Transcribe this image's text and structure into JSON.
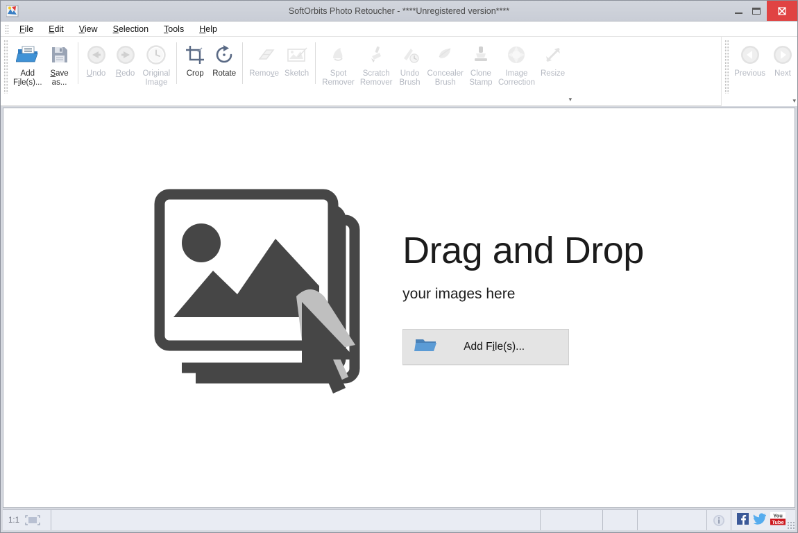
{
  "window": {
    "title": "SoftOrbits Photo Retoucher - ****Unregistered version****",
    "app_icon": "photo-retoucher-icon",
    "minimize_label": "Minimize",
    "maximize_label": "Maximize",
    "close_label": "Close",
    "close_color": "#e04343"
  },
  "menubar": {
    "items": [
      {
        "label": "File",
        "mnemonic": "F"
      },
      {
        "label": "Edit",
        "mnemonic": "E"
      },
      {
        "label": "View",
        "mnemonic": "V"
      },
      {
        "label": "Selection",
        "mnemonic": "S"
      },
      {
        "label": "Tools",
        "mnemonic": "T"
      },
      {
        "label": "Help",
        "mnemonic": "H"
      }
    ]
  },
  "toolbar": {
    "overflow_label": "▾",
    "groups": [
      {
        "name": "file-group",
        "tools": [
          {
            "name": "add-files",
            "label": "Add\nFile(s)...",
            "icon": "open-folder-icon",
            "enabled": true
          },
          {
            "name": "save-as",
            "label": "Save\nas...",
            "icon": "floppy-disk-icon",
            "enabled": true
          }
        ]
      },
      {
        "name": "history-group",
        "tools": [
          {
            "name": "undo",
            "label": "Undo",
            "icon": "arrow-left-circle-icon",
            "enabled": false
          },
          {
            "name": "redo",
            "label": "Redo",
            "icon": "arrow-right-circle-icon",
            "enabled": false
          },
          {
            "name": "original-image",
            "label": "Original\nImage",
            "icon": "clock-icon",
            "enabled": false
          }
        ]
      },
      {
        "name": "transform-group",
        "tools": [
          {
            "name": "crop",
            "label": "Crop",
            "icon": "crop-icon",
            "enabled": true
          },
          {
            "name": "rotate",
            "label": "Rotate",
            "icon": "rotate-icon",
            "enabled": true
          }
        ]
      },
      {
        "name": "effects-group",
        "tools": [
          {
            "name": "remove",
            "label": "Remove",
            "icon": "eraser-icon",
            "enabled": false
          },
          {
            "name": "sketch",
            "label": "Sketch",
            "icon": "sketch-icon",
            "enabled": false
          }
        ]
      },
      {
        "name": "retouch-group",
        "tools": [
          {
            "name": "spot-remover",
            "label": "Spot\nRemover",
            "icon": "spot-remover-icon",
            "enabled": false
          },
          {
            "name": "scratch-remover",
            "label": "Scratch\nRemover",
            "icon": "brush-icon",
            "enabled": false
          },
          {
            "name": "undo-brush",
            "label": "Undo\nBrush",
            "icon": "undo-brush-icon",
            "enabled": false
          },
          {
            "name": "concealer-brush",
            "label": "Concealer\nBrush",
            "icon": "concealer-brush-icon",
            "enabled": false
          },
          {
            "name": "clone-stamp",
            "label": "Clone\nStamp",
            "icon": "stamp-icon",
            "enabled": false
          },
          {
            "name": "image-correction",
            "label": "Image\nCorrection",
            "icon": "color-wheel-icon",
            "enabled": false
          },
          {
            "name": "resize",
            "label": "Resize",
            "icon": "resize-arrow-icon",
            "enabled": false
          }
        ]
      }
    ],
    "navigation": {
      "overflow_label": "▾",
      "tools": [
        {
          "name": "previous",
          "label": "Previous",
          "icon": "arrow-left-circle-icon",
          "enabled": false
        },
        {
          "name": "next",
          "label": "Next",
          "icon": "arrow-right-circle-icon",
          "enabled": false
        }
      ]
    }
  },
  "canvas": {
    "illustration": "photos-stack-with-cursor-icon",
    "headline": "Drag and Drop",
    "subhead": "your images here",
    "add_button": {
      "label": "Add File(s)...",
      "mnemonic": "i",
      "icon": "folder-icon"
    }
  },
  "statusbar": {
    "zoom_level": "1:1",
    "fit_icon": "fit-to-window-icon",
    "panels": [
      "",
      "",
      "",
      ""
    ],
    "info_icon": "info-icon",
    "social": [
      {
        "name": "facebook-icon",
        "label": "f",
        "color": "#3b5998"
      },
      {
        "name": "twitter-icon",
        "label": "t",
        "color": "#55acee"
      },
      {
        "name": "youtube-icon",
        "label": "You\nTube",
        "color": "#cc181e"
      }
    ]
  }
}
